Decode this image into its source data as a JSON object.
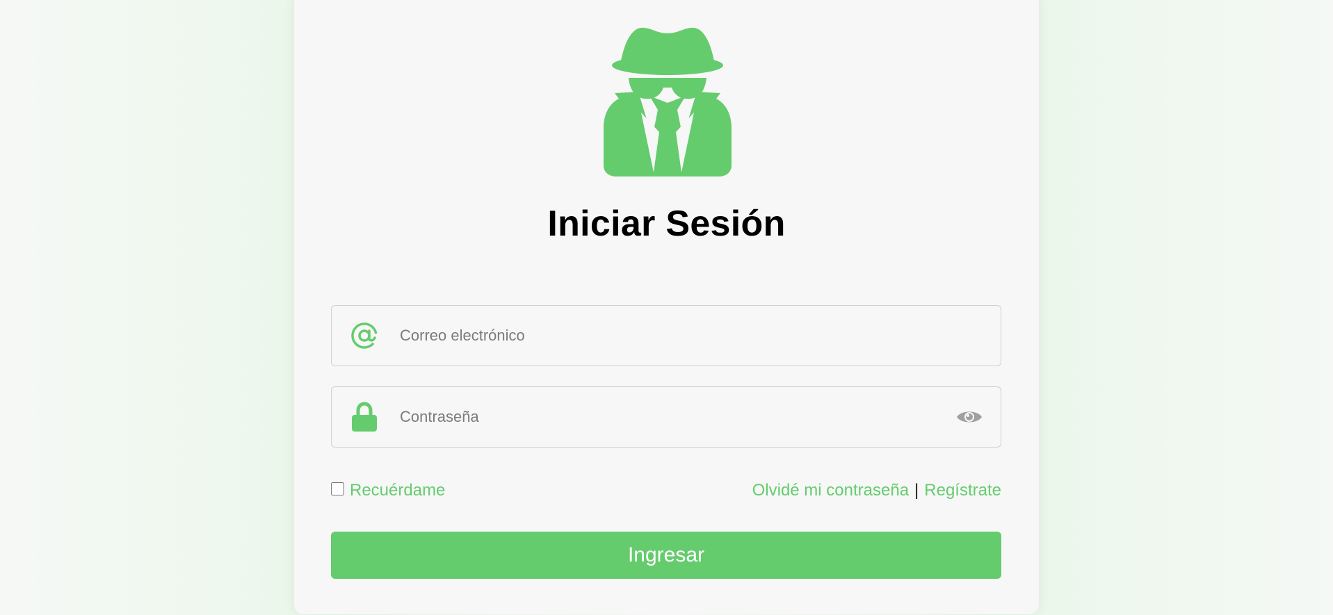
{
  "login": {
    "title": "Iniciar Sesión",
    "email_placeholder": "Correo electrónico",
    "email_value": "",
    "password_placeholder": "Contraseña",
    "password_value": "",
    "remember_label": "Recuérdame",
    "remember_checked": false,
    "forgot_label": "Olvidé mi contraseña",
    "separator": "|",
    "register_label": "Regístrate",
    "submit_label": "Ingresar"
  },
  "icons": {
    "logo": "incognito-spy-icon",
    "email": "at-sign-icon",
    "password": "lock-icon",
    "toggle": "eye-icon"
  },
  "colors": {
    "accent": "#65cc6e",
    "card": "#f7f7f7",
    "title": "#000000",
    "eye": "#a0a0a0"
  }
}
